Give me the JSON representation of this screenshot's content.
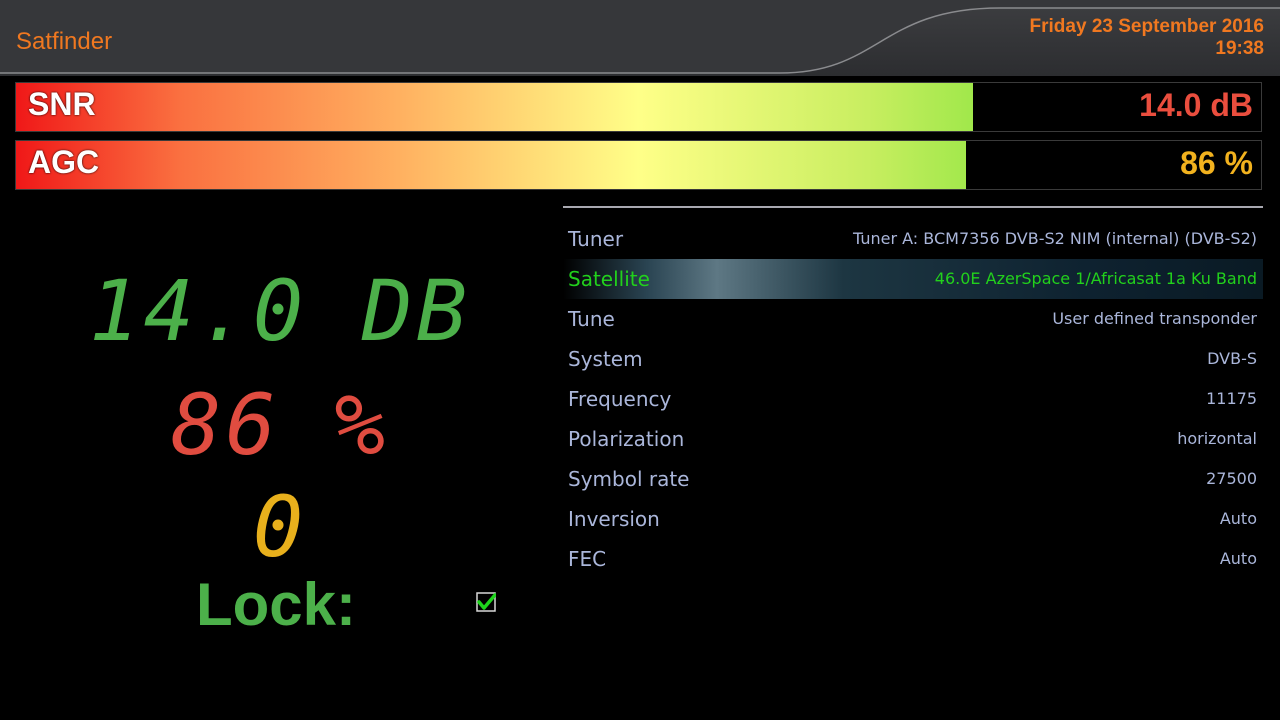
{
  "header": {
    "title": "Satfinder",
    "date": "Friday 23 September 2016",
    "time": "19:38"
  },
  "colors": {
    "accent": "#f07820",
    "snr": "#4cb04a",
    "agc": "#e04c40",
    "ber": "#e8b01c",
    "selected": "#22d01c",
    "list_text": "#aab6da"
  },
  "signal_bars": {
    "snr": {
      "label": "SNR",
      "value": "14.0 dB",
      "fill_fraction": 0.876
    },
    "agc": {
      "label": "AGC",
      "value": "86 %",
      "fill_fraction": 0.87
    }
  },
  "readouts": {
    "snr": "14.0 DB",
    "agc": "86 %",
    "ber": "0",
    "lock_label": "Lock:",
    "lock_checked": true,
    "lock_icon": "checkmark-icon"
  },
  "info": {
    "rows": [
      {
        "label": "Tuner",
        "value": "Tuner A: BCM7356 DVB-S2 NIM (internal) (DVB-S2)",
        "selected": false
      },
      {
        "label": "Satellite",
        "value": "46.0E AzerSpace 1/Africasat 1a Ku Band",
        "selected": true
      },
      {
        "label": "Tune",
        "value": "User defined transponder",
        "selected": false
      },
      {
        "label": "System",
        "value": "DVB-S",
        "selected": false
      },
      {
        "label": "Frequency",
        "value": "11175",
        "selected": false
      },
      {
        "label": "Polarization",
        "value": "horizontal",
        "selected": false
      },
      {
        "label": "Symbol rate",
        "value": "27500",
        "selected": false
      },
      {
        "label": "Inversion",
        "value": "Auto",
        "selected": false
      },
      {
        "label": "FEC",
        "value": "Auto",
        "selected": false
      }
    ]
  }
}
